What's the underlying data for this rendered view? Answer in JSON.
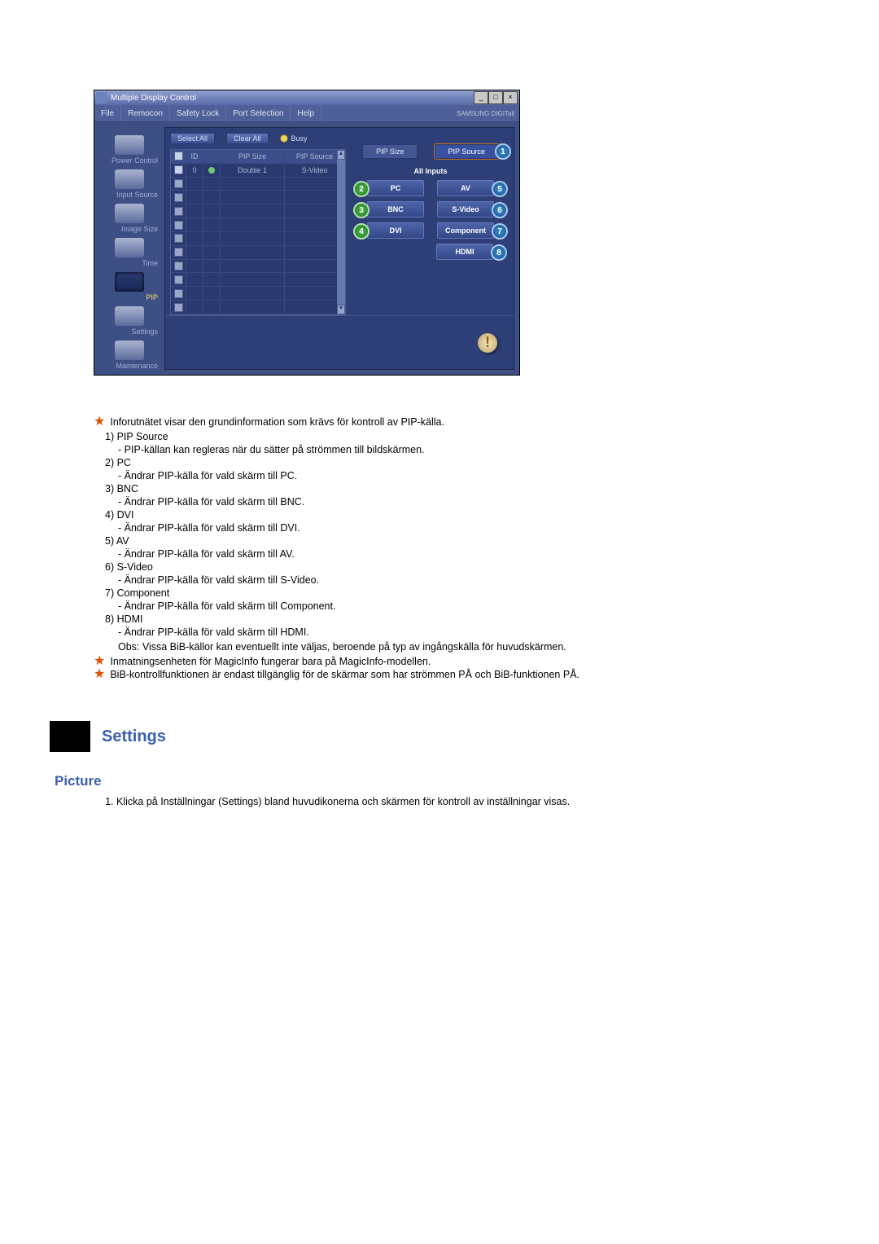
{
  "window": {
    "title": "Multiple Display Control",
    "brand": "SAMSUNG DIGITall"
  },
  "menu": {
    "file": "File",
    "remocon": "Remocon",
    "safety": "Safety Lock",
    "port": "Port Selection",
    "help": "Help"
  },
  "sidebar": {
    "power": "Power Control",
    "input": "Input Source",
    "image": "Image Size",
    "time": "Time",
    "pip": "PIP",
    "settings": "Settings",
    "maint": "Maintenance"
  },
  "grid": {
    "select_all": "Select All",
    "clear_all": "Clear All",
    "busy": "Busy",
    "head_id": "ID",
    "head_col1": "PIP Size",
    "head_col2": "PIP Source",
    "row0_id": "0",
    "row0_c1": "Double 1",
    "row0_c2": "S-Video"
  },
  "panel": {
    "left_head": "PIP Size",
    "right_head": "PIP Source",
    "marker1": "1",
    "all_inputs": "All Inputs",
    "pc": "PC",
    "m_pc": "2",
    "bnc": "BNC",
    "m_bnc": "3",
    "dvi": "DVI",
    "m_dvi": "4",
    "av": "AV",
    "m_av": "5",
    "svideo": "S-Video",
    "m_sv": "6",
    "component": "Component",
    "m_cp": "7",
    "hdmi": "HDMI",
    "m_hd": "8"
  },
  "doc": {
    "intro": "Inforutnätet visar den grundinformation som krävs för kontroll av PIP-källa.",
    "i1t": "1)  PIP Source",
    "i1d": "- PIP-källan kan regleras när du sätter på strömmen till bildskärmen.",
    "i2t": "2)  PC",
    "i2d": "- Ändrar PIP-källa för vald skärm till PC.",
    "i3t": "3)  BNC",
    "i3d": "- Ändrar PIP-källa för vald skärm till BNC.",
    "i4t": "4)  DVI",
    "i4d": "- Ändrar PIP-källa för vald skärm till DVI.",
    "i5t": "5)  AV",
    "i5d": "- Ändrar PIP-källa för vald skärm till AV.",
    "i6t": "6)  S-Video",
    "i6d": "- Ändrar PIP-källa för vald skärm till S-Video.",
    "i7t": "7)  Component",
    "i7d": "- Ändrar PIP-källa för vald skärm till Component.",
    "i8t": "8)  HDMI",
    "i8d": "- Ändrar PIP-källa för vald skärm till HDMI.",
    "obs": "Obs: Vissa BiB-källor kan eventuellt inte väljas, beroende på typ av ingångskälla för huvudskärmen.",
    "note_magic": "Inmatningsenheten för MagicInfo fungerar bara på MagicInfo-modellen.",
    "note_bib": "BiB-kontrollfunktionen är endast tillgänglig för de skärmar som har strömmen PÅ och BiB-funktionen PÅ.",
    "settings_title": "Settings",
    "picture_title": "Picture",
    "pic1": "Klicka på Inställningar (Settings) bland huvudikonerna och skärmen för kontroll av inställningar visas."
  }
}
